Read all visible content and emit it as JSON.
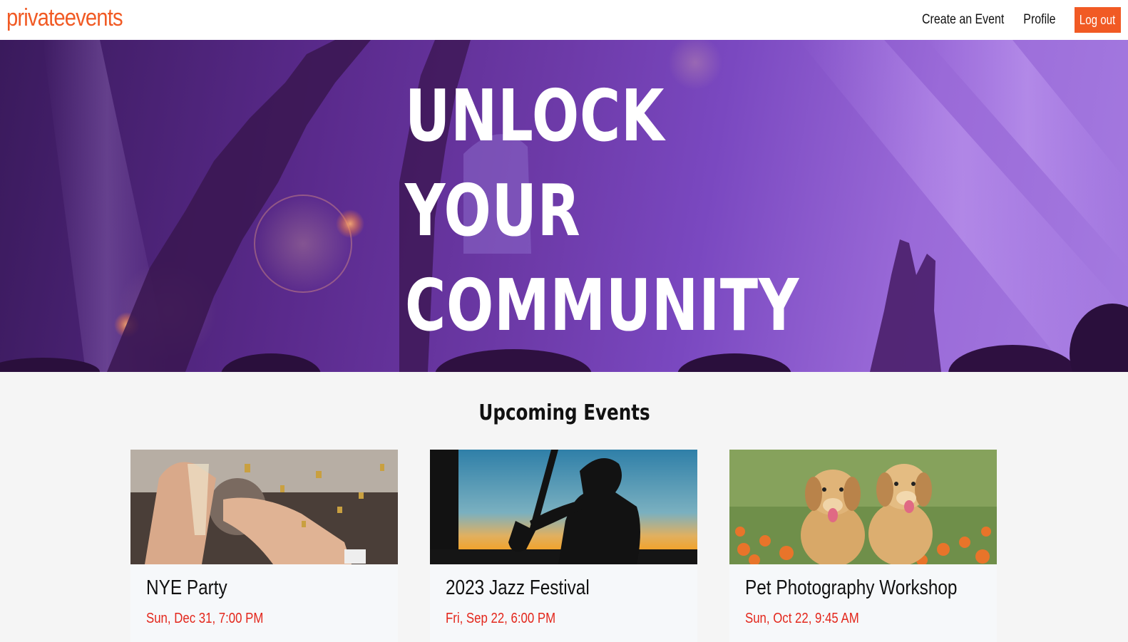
{
  "navbar": {
    "brand": "privateevents",
    "links": [
      {
        "label": "Create an Event"
      },
      {
        "label": "Profile"
      }
    ],
    "logout_label": "Log out"
  },
  "hero": {
    "lines": [
      "UNLOCK",
      "YOUR",
      "COMMUNITY"
    ]
  },
  "events_section": {
    "title": "Upcoming Events",
    "events": [
      {
        "name": "NYE Party",
        "date": "Sun, Dec 31, 7:00 PM",
        "image": "party-toast-confetti-photo"
      },
      {
        "name": "2023 Jazz Festival",
        "date": "Fri, Sep 22, 6:00 PM",
        "image": "saxophone-silhouette-sunset-photo"
      },
      {
        "name": "Pet Photography Workshop",
        "date": "Sun, Oct 22, 9:45 AM",
        "image": "golden-puppies-flowers-photo"
      }
    ]
  },
  "colors": {
    "accent": "#f15a24",
    "date_red": "#e3261b",
    "hero_purple": "#6d3aa8"
  }
}
